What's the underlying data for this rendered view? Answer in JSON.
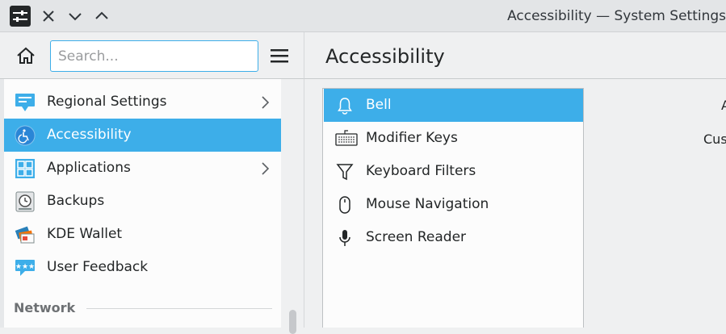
{
  "window": {
    "title": "Accessibility — System Settings"
  },
  "search": {
    "placeholder": "Search...",
    "value": ""
  },
  "page": {
    "title": "Accessibility"
  },
  "sidebar": {
    "items": [
      {
        "label": "Regional Settings",
        "icon": "regional-settings-icon",
        "has_children": true
      },
      {
        "label": "Accessibility",
        "icon": "accessibility-icon",
        "selected": true
      },
      {
        "label": "Applications",
        "icon": "applications-icon",
        "has_children": true
      },
      {
        "label": "Backups",
        "icon": "backups-icon"
      },
      {
        "label": "KDE Wallet",
        "icon": "kde-wallet-icon"
      },
      {
        "label": "User Feedback",
        "icon": "user-feedback-icon"
      }
    ],
    "section_header": "Network"
  },
  "modules": {
    "items": [
      {
        "label": "Bell",
        "icon": "bell-icon",
        "selected": true
      },
      {
        "label": "Modifier Keys",
        "icon": "keyboard-icon"
      },
      {
        "label": "Keyboard Filters",
        "icon": "filter-icon"
      },
      {
        "label": "Mouse Navigation",
        "icon": "mouse-icon"
      },
      {
        "label": "Screen Reader",
        "icon": "microphone-icon"
      }
    ]
  },
  "right_panel": {
    "partial_text_1": "A",
    "partial_text_2": "Cus"
  },
  "colors": {
    "accent": "#3daee9",
    "window_bg": "#eff0f1",
    "view_bg": "#fcfcfc",
    "text": "#232627"
  }
}
